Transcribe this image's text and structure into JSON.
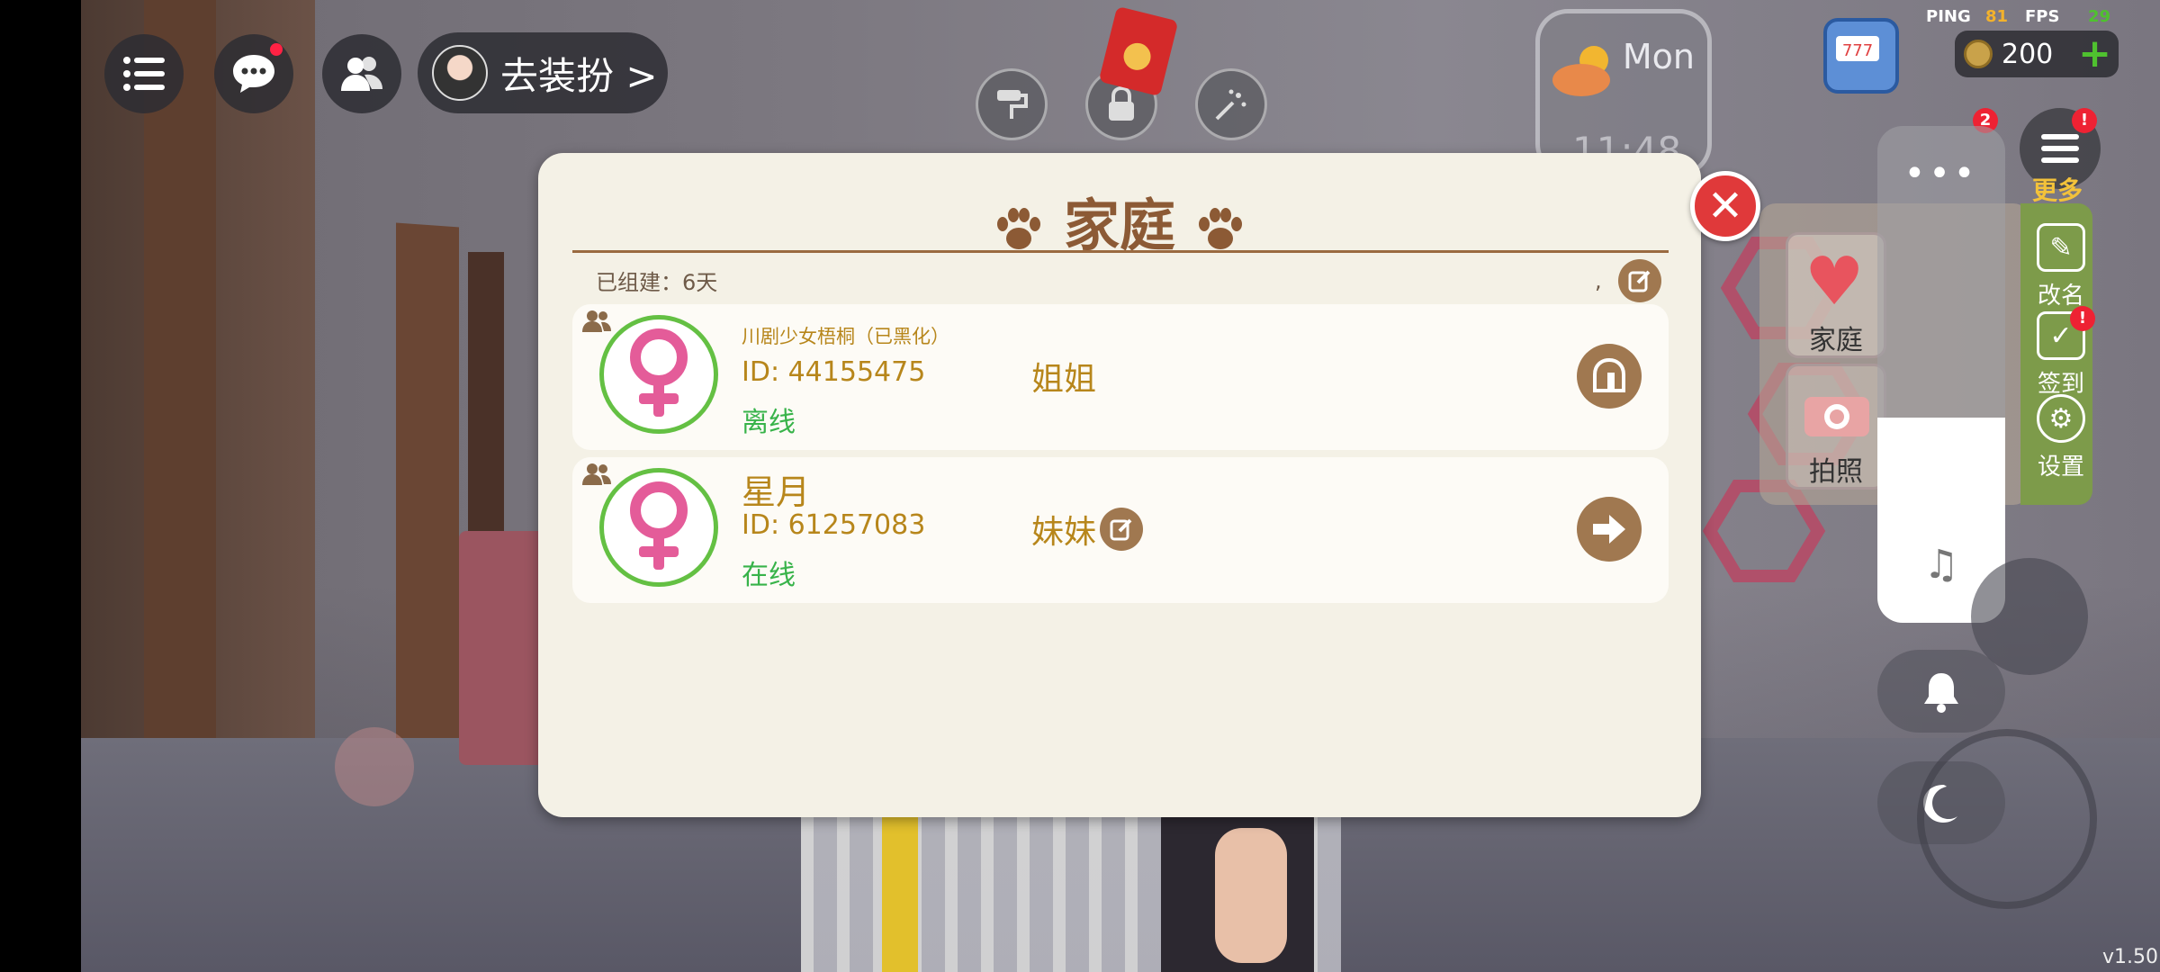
{
  "hud": {
    "dress_up_label": "去装扮 >",
    "ping_label": "PING",
    "ping_value": "81",
    "fps_label": "FPS",
    "fps_value": "29",
    "coins": "200",
    "weather_day": "Mon",
    "weather_time": "11:48",
    "version": "v1.50"
  },
  "side_menu": {
    "more_label": "更多",
    "more_badge": "2",
    "rename_label": "改名",
    "signin_label": "签到",
    "settings_label": "设置",
    "family_label": "家庭",
    "photo_label": "拍照"
  },
  "quick_panel": {
    "dots": "•••"
  },
  "dialog": {
    "title": "家庭",
    "founded_text": "已组建：6天",
    "comma": ",",
    "members": [
      {
        "name": "川剧少女梧桐（已黑化）",
        "id_text": "ID: 44155475",
        "relation": "姐姐",
        "status": "离线"
      },
      {
        "name": "星月",
        "id_text": "ID: 61257083",
        "relation": "妹妹",
        "status": "在线"
      }
    ]
  },
  "colors": {
    "dialog_bg": "#f4f1e6",
    "title_brown": "#8c5a35",
    "gold_text": "#b7861b",
    "online_green": "#38b34a",
    "close_red": "#e0393a"
  },
  "icons": {
    "menu": "menu-icon",
    "chat": "chat-icon",
    "friends": "friends-icon",
    "paint_roller": "paint-roller-icon",
    "lock": "lock-icon",
    "fireworks": "fireworks-icon",
    "music": "music-note-icon",
    "bell": "bell-icon",
    "moon": "moon-icon"
  }
}
